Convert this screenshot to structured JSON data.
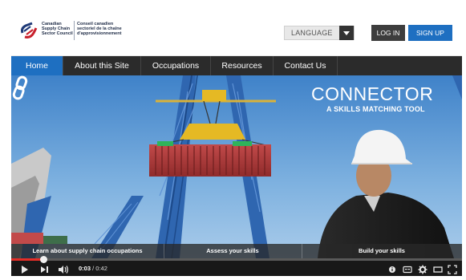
{
  "logo": {
    "english_lines": [
      "Canadian",
      "Supply Chain",
      "Sector Council"
    ],
    "french_lines": [
      "Conseil canadien",
      "sectoriel de la chaîne",
      "d'approvisionnement"
    ],
    "colors": {
      "blue": "#1f3a78",
      "red": "#c8202c"
    }
  },
  "header": {
    "language_label": "LANGUAGE",
    "login_label": "LOG IN",
    "signup_label": "SIGN UP"
  },
  "nav": {
    "items": [
      {
        "label": "Home",
        "active": true
      },
      {
        "label": "About this Site",
        "active": false
      },
      {
        "label": "Occupations",
        "active": false
      },
      {
        "label": "Resources",
        "active": false
      },
      {
        "label": "Contact Us",
        "active": false
      }
    ],
    "active_color": "#1e6fc1"
  },
  "hero": {
    "brand_title": "CONNECTOR",
    "brand_subtitle": "A SKILLS MATCHING TOOL",
    "brand_icon": "chain-link-icon",
    "cta": [
      "Learn about supply chain occupations",
      "Assess your skills",
      "Build your skills"
    ]
  },
  "video": {
    "current_time": "0:03",
    "separator": " / ",
    "duration": "0:42",
    "progress_fraction": 0.071,
    "progress_color": "#e52d27",
    "icons": [
      "play-icon",
      "next-icon",
      "volume-icon",
      "info-icon",
      "captions-icon",
      "settings-icon",
      "theater-icon",
      "fullscreen-icon"
    ]
  }
}
